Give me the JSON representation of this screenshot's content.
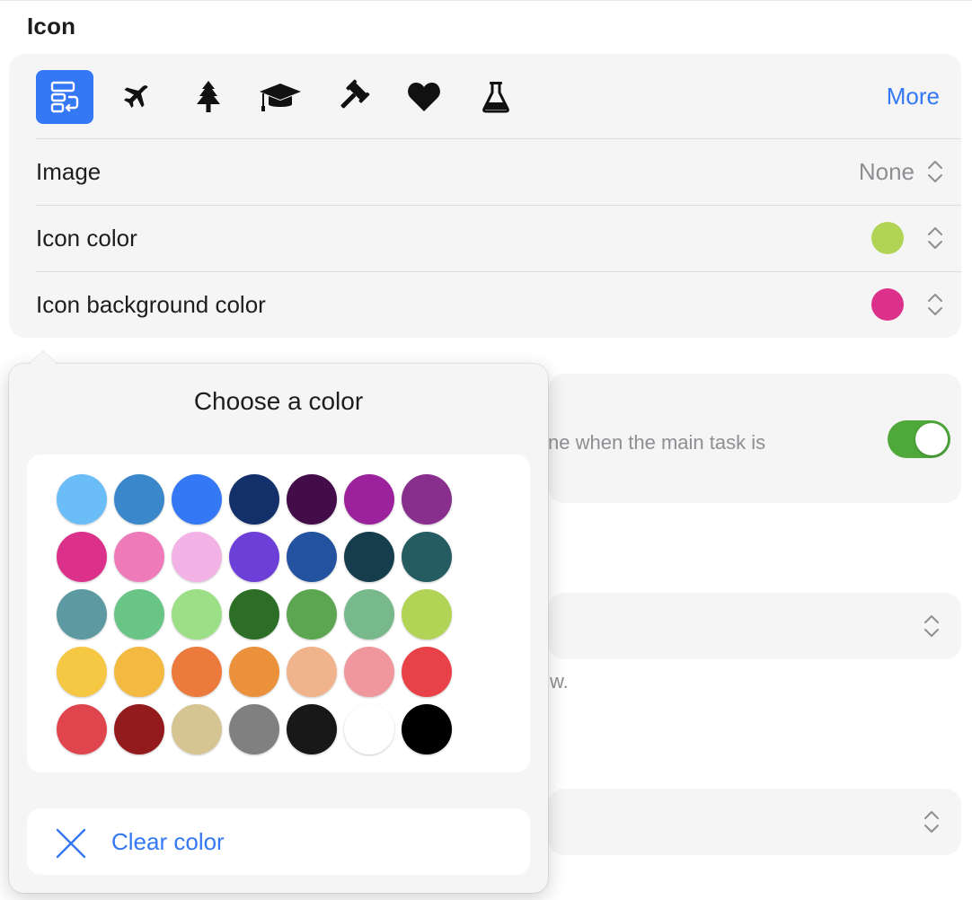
{
  "section_title": "Icon",
  "icon_picker": {
    "icons": [
      {
        "name": "flow-icon",
        "selected": true
      },
      {
        "name": "airplane-icon",
        "selected": false
      },
      {
        "name": "tree-icon",
        "selected": false
      },
      {
        "name": "graduation-cap-icon",
        "selected": false
      },
      {
        "name": "gavel-icon",
        "selected": false
      },
      {
        "name": "heart-icon",
        "selected": false
      },
      {
        "name": "flask-icon",
        "selected": false
      }
    ],
    "more_label": "More",
    "accent_color": "#3478f6"
  },
  "rows": {
    "image": {
      "label": "Image",
      "value": "None"
    },
    "icon_color": {
      "label": "Icon color",
      "color": "#b2d456"
    },
    "icon_background_color": {
      "label": "Icon background color",
      "color": "#dc318a"
    }
  },
  "background": {
    "partial_text_1": "ne when the main task is",
    "toggle_on": true,
    "toggle_color": "#4ea83a",
    "partial_text_2": "w."
  },
  "color_picker": {
    "title": "Choose a color",
    "swatches": [
      "#6bbdf8",
      "#3a87cc",
      "#3478f6",
      "#14306a",
      "#440d4a",
      "#9b229c",
      "#882e8c",
      "#dc318a",
      "#ee7ab9",
      "#f3b2e6",
      "#6d3fd9",
      "#2352a0",
      "#163d4b",
      "#245c61",
      "#5c99a0",
      "#68c585",
      "#9cdf86",
      "#2d6e26",
      "#5ca551",
      "#78b98c",
      "#b2d456",
      "#f6c742",
      "#f3b940",
      "#eb7a3c",
      "#eb913c",
      "#f0b38c",
      "#ef979c",
      "#e84147",
      "#e0454e",
      "#931b1e",
      "#d6c593",
      "#808080",
      "#181818",
      "#ffffff",
      "#000000"
    ],
    "clear_label": "Clear color"
  }
}
